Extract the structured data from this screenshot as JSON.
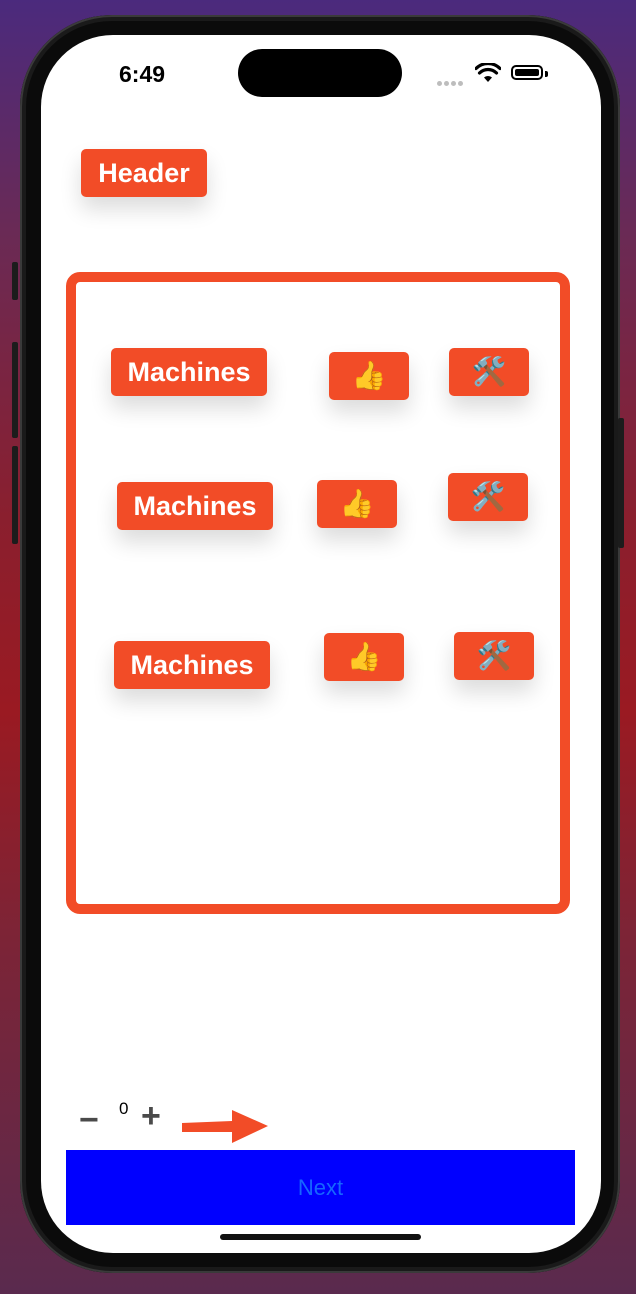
{
  "status_bar": {
    "time": "6:49"
  },
  "header": {
    "label": "Header"
  },
  "list": {
    "rows": [
      {
        "label": "Machines",
        "like_icon": "👍",
        "tools_icon": "🛠️"
      },
      {
        "label": "Machines",
        "like_icon": "👍",
        "tools_icon": "🛠️"
      },
      {
        "label": "Machines",
        "like_icon": "👍",
        "tools_icon": "🛠️"
      }
    ]
  },
  "stepper": {
    "minus": "−",
    "value": "0",
    "plus": "+"
  },
  "next_button": {
    "label": "Next"
  },
  "colors": {
    "accent": "#f24c27",
    "next_bg": "#0000ff",
    "next_text": "#1666ff"
  }
}
